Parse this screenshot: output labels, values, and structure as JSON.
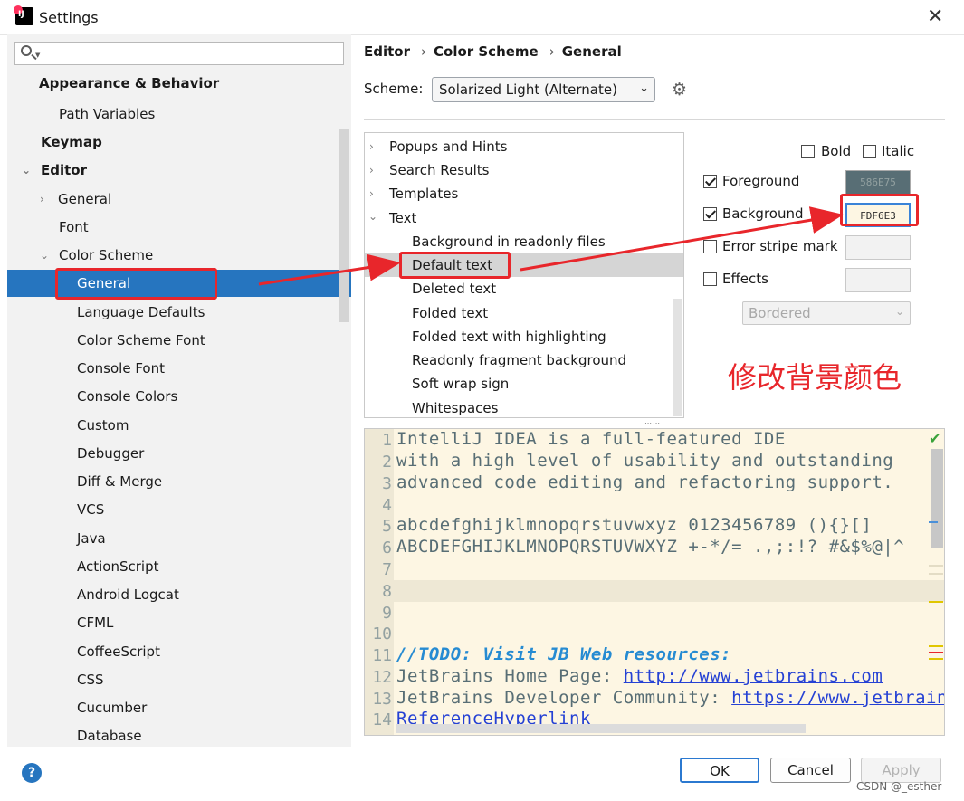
{
  "window": {
    "title": "Settings",
    "app_icon": "intellij-idea-icon"
  },
  "search": {
    "placeholder": ""
  },
  "tree": [
    {
      "label": "Appearance & Behavior",
      "bold": true
    },
    {
      "label": "Path Variables"
    },
    {
      "label": "Keymap",
      "bold": true
    },
    {
      "label": "Editor",
      "bold": true,
      "expanded": true
    },
    {
      "label": "General",
      "collapsed": true
    },
    {
      "label": "Font"
    },
    {
      "label": "Color Scheme",
      "expanded": true
    },
    {
      "label": "General",
      "selected": true
    },
    {
      "label": "Language Defaults"
    },
    {
      "label": "Color Scheme Font"
    },
    {
      "label": "Console Font"
    },
    {
      "label": "Console Colors"
    },
    {
      "label": "Custom"
    },
    {
      "label": "Debugger"
    },
    {
      "label": "Diff & Merge"
    },
    {
      "label": "VCS"
    },
    {
      "label": "Java"
    },
    {
      "label": "ActionScript"
    },
    {
      "label": "Android Logcat"
    },
    {
      "label": "CFML"
    },
    {
      "label": "CoffeeScript"
    },
    {
      "label": "CSS"
    },
    {
      "label": "Cucumber"
    },
    {
      "label": "Database"
    }
  ],
  "breadcrumb": {
    "part1": "Editor",
    "part2": "Color Scheme",
    "part3": "General"
  },
  "scheme": {
    "label": "Scheme:",
    "value": "Solarized Light (Alternate)"
  },
  "attributes": [
    {
      "label": "Popups and Hints",
      "collapsed": true
    },
    {
      "label": "Search Results",
      "collapsed": true
    },
    {
      "label": "Templates",
      "collapsed": true
    },
    {
      "label": "Text",
      "expanded": true
    },
    {
      "label": "Background in readonly files"
    },
    {
      "label": "Default text",
      "selected": true
    },
    {
      "label": "Deleted text"
    },
    {
      "label": "Folded text"
    },
    {
      "label": "Folded text with highlighting"
    },
    {
      "label": "Readonly fragment background"
    },
    {
      "label": "Soft wrap sign"
    },
    {
      "label": "Whitespaces"
    }
  ],
  "options": {
    "bold": {
      "label": "Bold",
      "checked": false
    },
    "italic": {
      "label": "Italic",
      "checked": false
    },
    "foreground": {
      "label": "Foreground",
      "checked": true,
      "value": "586E75",
      "color": "#586e75"
    },
    "background": {
      "label": "Background",
      "checked": true,
      "value": "FDF6E3",
      "color": "#fdf6e3"
    },
    "error_stripe": {
      "label": "Error stripe mark",
      "checked": false
    },
    "effects": {
      "label": "Effects",
      "checked": false,
      "type": "Bordered"
    }
  },
  "annotation": "修改背景颜色",
  "preview": {
    "lines": [
      {
        "n": "1",
        "text": "IntelliJ IDEA is a full-featured IDE"
      },
      {
        "n": "2",
        "text": "with a high level of usability and outstanding"
      },
      {
        "n": "3",
        "text": "advanced code editing and refactoring support."
      },
      {
        "n": "4",
        "text": ""
      },
      {
        "n": "5",
        "text": "abcdefghijklmnopqrstuvwxyz 0123456789 (){}[]"
      },
      {
        "n": "6",
        "text": "ABCDEFGHIJKLMNOPQRSTUVWXYZ +-*/= .,;:!? #&$%@|^"
      },
      {
        "n": "7",
        "text": ""
      },
      {
        "n": "8",
        "text": ""
      },
      {
        "n": "9",
        "text": ""
      },
      {
        "n": "10",
        "text": ""
      },
      {
        "n": "11",
        "todo": "//TODO: Visit JB Web resources:"
      },
      {
        "n": "12",
        "prefix": "JetBrains Home Page: ",
        "link": "http://www.jetbrains.com"
      },
      {
        "n": "13",
        "prefix": "JetBrains Developer Community: ",
        "link": "https://www.jetbrain"
      },
      {
        "n": "14",
        "link": "ReferenceHyperlink"
      }
    ]
  },
  "buttons": {
    "ok": "OK",
    "cancel": "Cancel",
    "apply": "Apply",
    "help": "?"
  },
  "watermark": "CSDN @_esther",
  "colors": {
    "selection": "#2675bf",
    "annotation_red": "#e8262b",
    "preview_bg": "#fdf6e3",
    "preview_fg": "#586e75"
  }
}
